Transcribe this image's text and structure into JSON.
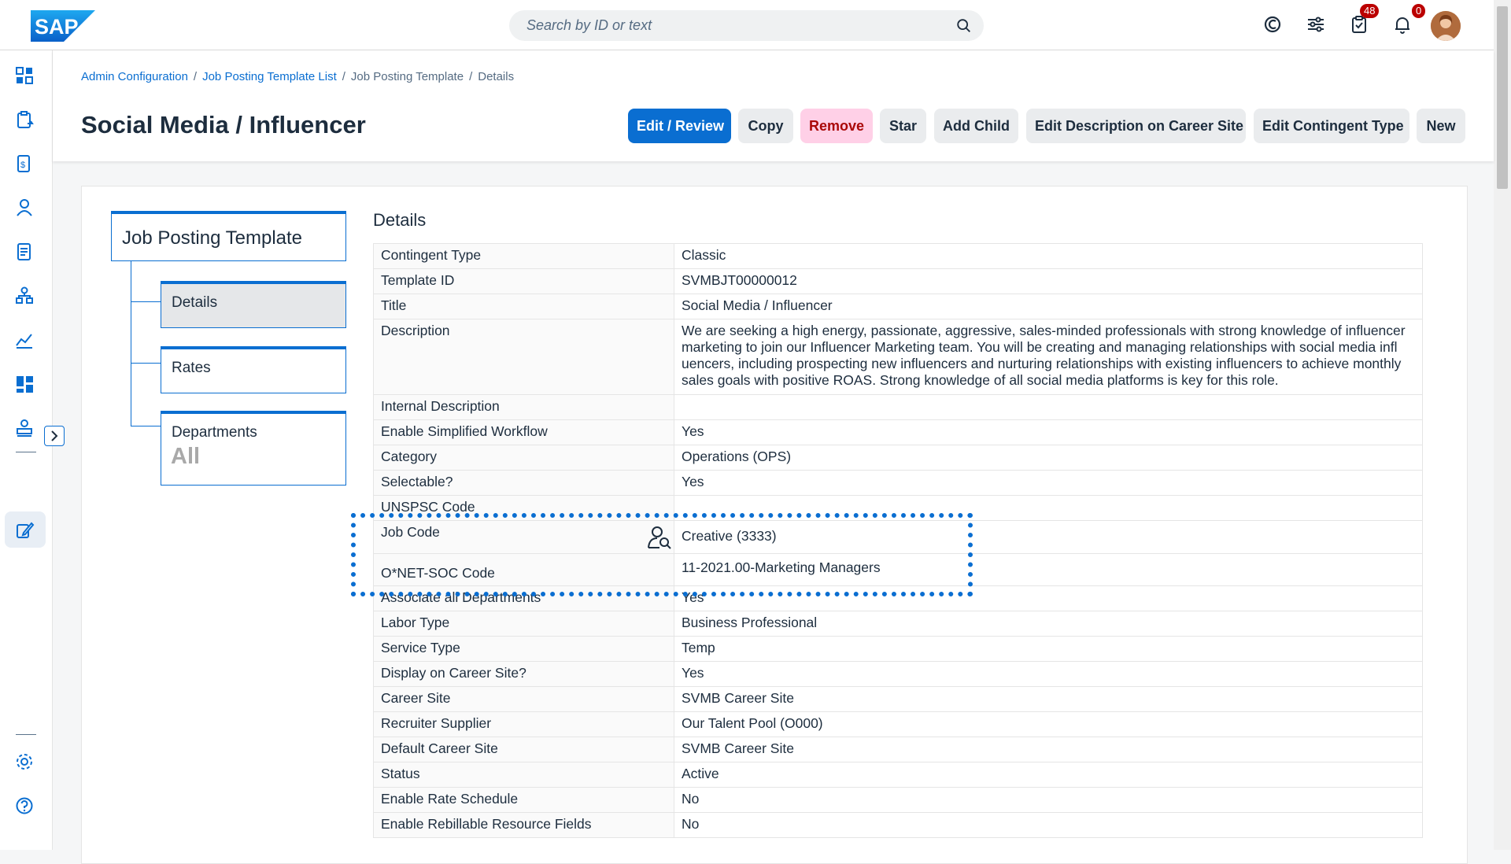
{
  "topbar": {
    "logo_text": "SAP",
    "search_placeholder": "Search by ID or text",
    "tasks_badge": "48",
    "notifications_badge": "0"
  },
  "breadcrumb": {
    "items": [
      "Admin Configuration",
      "Job Posting Template List",
      "Job Posting Template",
      "Details"
    ]
  },
  "page": {
    "title": "Social Media / Influencer"
  },
  "actions": {
    "edit_review": "Edit / Review",
    "copy": "Copy",
    "remove": "Remove",
    "star": "Star",
    "add_child": "Add Child",
    "edit_description": "Edit Description on Career Site",
    "edit_contingent": "Edit Contingent Type",
    "new": "New"
  },
  "tree": {
    "root": "Job Posting Template",
    "details": "Details",
    "rates": "Rates",
    "departments": "Departments",
    "departments_value": "All"
  },
  "details": {
    "heading": "Details",
    "rows": [
      {
        "label": "Contingent Type",
        "value": "Classic"
      },
      {
        "label": "Template ID",
        "value": "SVMBJT00000012"
      },
      {
        "label": "Title",
        "value": "Social Media / Influencer"
      },
      {
        "label": "Description",
        "value": "We are seeking a high energy, passionate, aggressive, sales-minded professionals with strong knowledge of influencer marketing to join our Influencer Marketing team. You will be creating and managing relationships with social media infl uencers, including prospecting new influencers and nurturing relationships with existing influencers to achieve monthly sales goals with positive ROAS. Strong knowledge of all social media platforms is key for this role."
      },
      {
        "label": "Internal Description",
        "value": ""
      },
      {
        "label": "Enable Simplified Workflow",
        "value": "Yes"
      },
      {
        "label": "Category",
        "value": "Operations (OPS)"
      },
      {
        "label": "Selectable?",
        "value": "Yes"
      },
      {
        "label": "UNSPSC Code",
        "value": ""
      },
      {
        "label": "Job Code",
        "value": "Creative (3333)"
      },
      {
        "label": "O*NET-SOC Code",
        "value": "11-2021.00-Marketing Managers"
      },
      {
        "label": "Associate all Departments",
        "value": "Yes"
      },
      {
        "label": "Labor Type",
        "value": "Business Professional"
      },
      {
        "label": "Service Type",
        "value": "Temp"
      },
      {
        "label": "Display on Career Site?",
        "value": "Yes"
      },
      {
        "label": "Career Site",
        "value": "SVMB Career Site"
      },
      {
        "label": "Recruiter Supplier",
        "value": "Our Talent Pool (O000)"
      },
      {
        "label": "Default Career Site",
        "value": "SVMB Career Site"
      },
      {
        "label": "Status",
        "value": "Active"
      },
      {
        "label": "Enable Rate Schedule",
        "value": "No"
      },
      {
        "label": "Enable Rebillable Resource Fields",
        "value": "No"
      }
    ]
  },
  "colors": {
    "primary": "#0a6ed1",
    "danger_bg": "#ffd0e7",
    "danger_text": "#aa0808",
    "badge": "#bb0000"
  }
}
